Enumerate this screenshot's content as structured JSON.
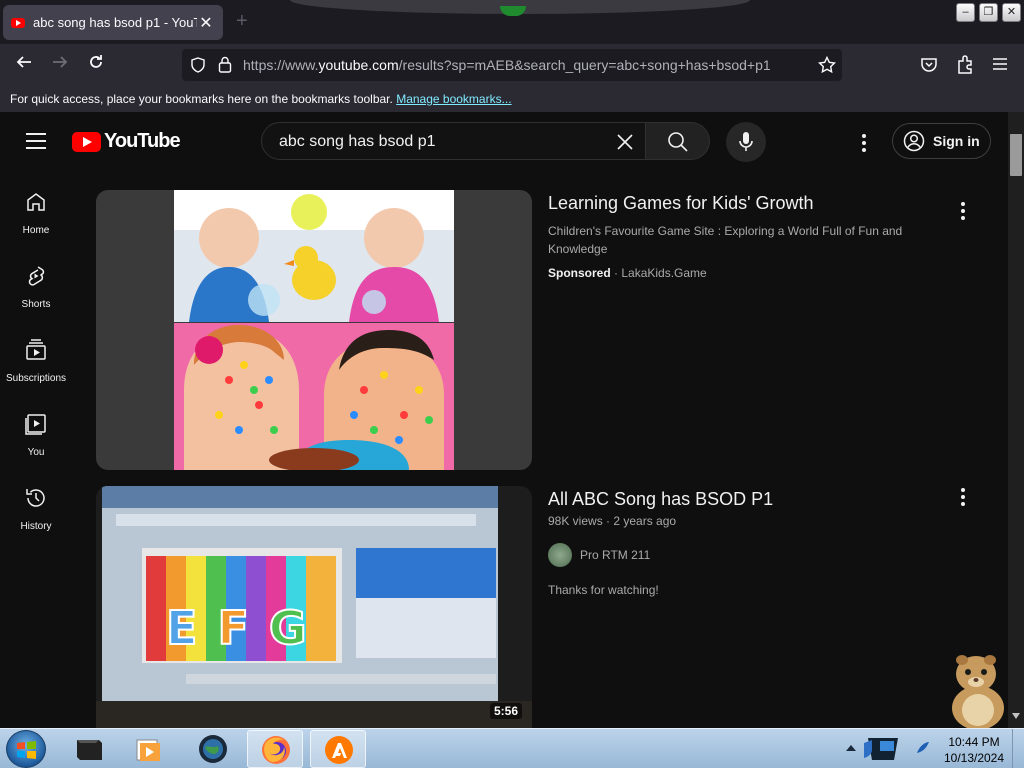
{
  "browser": {
    "tab_title": "abc song has bsod p1 - YouTube",
    "new_tab": "+",
    "close_tab": "✕",
    "url_prefix": "https://www.",
    "url_domain": "youtube.com",
    "url_rest": "/results?sp=mAEB&search_query=abc+song+has+bsod+p1",
    "bookmarks_text": "For quick access, place your bookmarks here on the bookmarks toolbar.",
    "bookmarks_link": "Manage bookmarks..."
  },
  "youtube": {
    "logo_text": "YouTube",
    "search_query": "abc song has bsod p1",
    "sign_in": "Sign in",
    "sidebar": [
      {
        "label": "Home"
      },
      {
        "label": "Shorts"
      },
      {
        "label": "Subscriptions"
      },
      {
        "label": "You"
      },
      {
        "label": "History"
      }
    ],
    "results": [
      {
        "title": "Learning Games for Kids' Growth",
        "description": "Children's Favourite Game Site : Exploring a World Full of Fun and Knowledge",
        "sponsored": "Sponsored",
        "advertiser": "· LakaKids.Game"
      },
      {
        "title": "All ABC Song has BSOD P1",
        "meta": "98K views · 2 years ago",
        "channel": "Pro RTM 211",
        "description": "Thanks for watching!",
        "duration": "5:56",
        "thumb_letters": [
          "E",
          "F",
          "G"
        ]
      }
    ]
  },
  "taskbar": {
    "time": "10:44 PM",
    "date": "10/13/2024"
  }
}
